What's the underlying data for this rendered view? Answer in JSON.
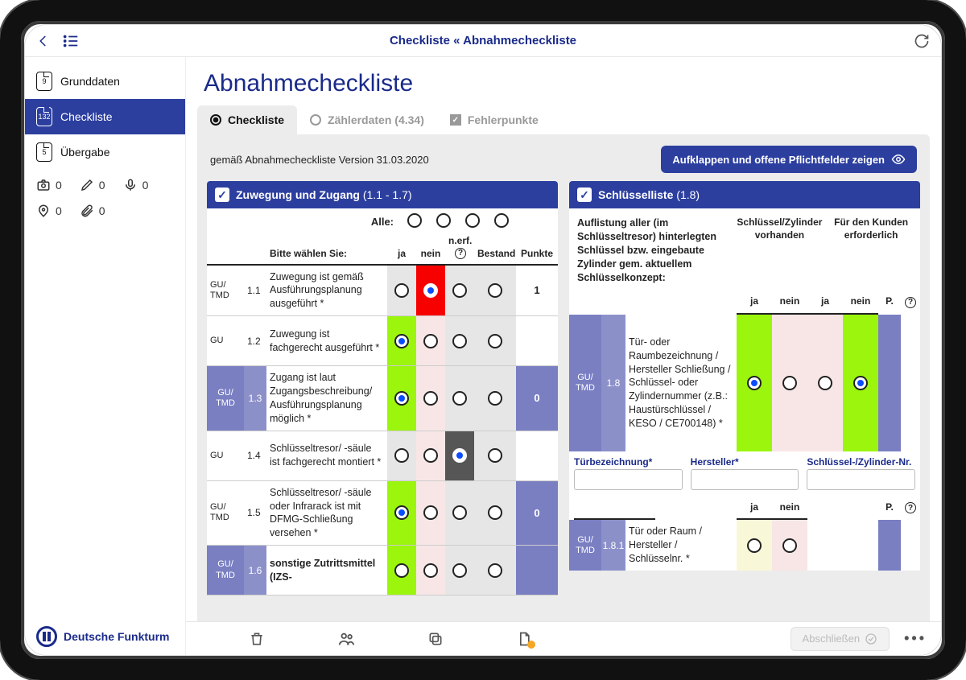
{
  "header": {
    "breadcrumb_a": "Checkliste",
    "breadcrumb_sep": "«",
    "breadcrumb_b": "Abnahmecheckliste"
  },
  "sidebar": {
    "items": [
      {
        "badge": "9",
        "label": "Grunddaten"
      },
      {
        "badge": "132",
        "label": "Checkliste"
      },
      {
        "badge": "5",
        "label": "Übergabe"
      }
    ],
    "counters": {
      "camera": "0",
      "pencil": "0",
      "mic": "0",
      "pin": "0",
      "clip": "0"
    },
    "brand": "Deutsche Funkturm"
  },
  "page": {
    "title": "Abnahmecheckliste",
    "tabs": [
      {
        "label": "Checkliste"
      },
      {
        "label": "Zählerdaten (4.34)"
      },
      {
        "label": "Fehlerpunkte"
      }
    ],
    "version_note": "gemäß Abnahmecheckliste Version 31.03.2020",
    "expand_btn": "Aufklappen und offene Pflichtfelder zeigen"
  },
  "left": {
    "section_title": "Zuwegung und Zugang",
    "section_range": "(1.1 - 1.7)",
    "all_label": "Alle:",
    "choose_label": "Bitte wählen Sie:",
    "cols": {
      "ja": "ja",
      "nein": "nein",
      "nerf": "n.erf.",
      "bestand": "Bestand",
      "punkte": "Punkte"
    },
    "rows": [
      {
        "tag": "GU/\nTMD",
        "num": "1.1",
        "txt": "Zuwegung ist gemäß Ausführungsplanung ausgeführt *",
        "sel": "nein",
        "pts": "1",
        "hl": false
      },
      {
        "tag": "GU",
        "num": "1.2",
        "txt": "Zuwegung ist fachgerecht ausgeführt *",
        "sel": "ja",
        "pts": "",
        "hl": false
      },
      {
        "tag": "GU/\nTMD",
        "num": "1.3",
        "txt": "Zugang ist laut Zugangsbeschreibung/ Ausführungsplanung möglich *",
        "sel": "ja",
        "pts": "0",
        "hl": true
      },
      {
        "tag": "GU",
        "num": "1.4",
        "txt": "Schlüsseltresor/ -säule ist fachgerecht montiert *",
        "sel": "nerf",
        "pts": "",
        "hl": false
      },
      {
        "tag": "GU/\nTMD",
        "num": "1.5",
        "txt": "Schlüsseltresor/ -säule oder Infrarack ist mit DFMG-Schließung versehen *",
        "sel": "ja",
        "pts": "0",
        "hl": false
      },
      {
        "tag": "GU/\nTMD",
        "num": "1.6",
        "txt": "sonstige Zutrittsmittel (IZS-",
        "sel": "",
        "pts": "",
        "hl": true,
        "bold": true
      }
    ]
  },
  "right": {
    "section_title": "Schlüsselliste",
    "section_range": "(1.8)",
    "intro": "Auflistung aller (im Schlüsseltresor) hinterlegten Schlüssel bzw. eingebaute Zylinder gem. aktuellem Schlüsselkonzept:",
    "hdr1": "Schlüssel/Zylinder vorhanden",
    "hdr2": "Für den Kunden erforderlich",
    "sub": {
      "ja": "ja",
      "nein": "nein",
      "p": "P."
    },
    "row": {
      "tag": "GU/\nTMD",
      "num": "1.8",
      "txt": "Tür- oder Raumbezeichnung / Hersteller Schließung / Schlüssel- oder Zylindernummer (z.B.: Haustürschlüssel / KESO / CE700148) *"
    },
    "fields": {
      "f1": "Türbezeichnung*",
      "f2": "Hersteller*",
      "f3": "Schlüssel-/Zylinder-Nr."
    },
    "row2": {
      "tag": "GU/\nTMD",
      "num": "1.8.1",
      "txt": "Tür oder Raum / Hersteller / Schlüsselnr. *"
    }
  },
  "bottom": {
    "close": "Abschließen"
  }
}
